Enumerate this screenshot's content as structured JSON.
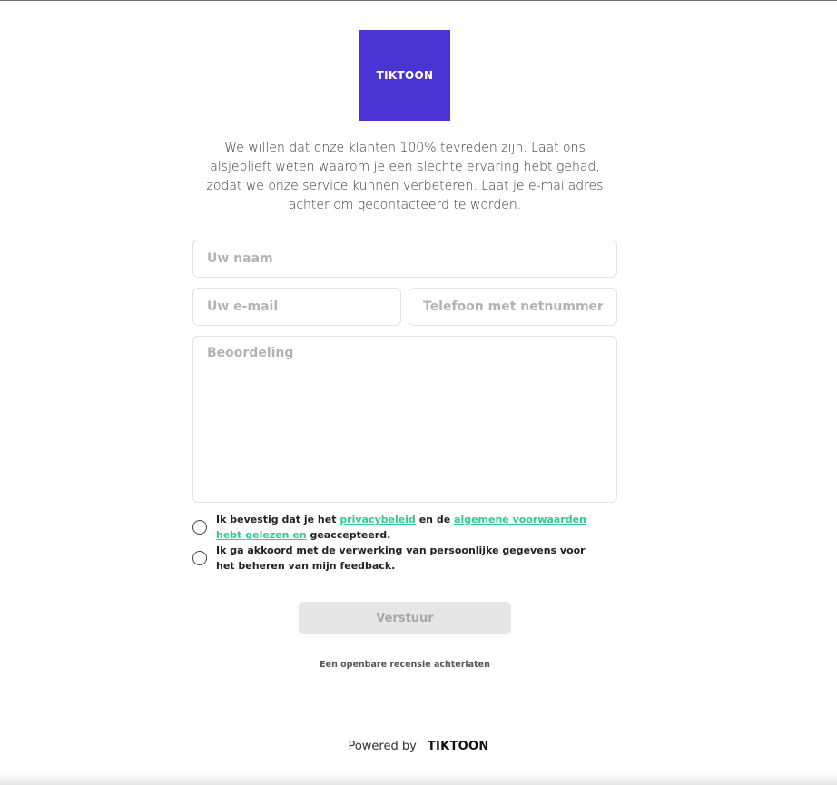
{
  "brand": {
    "logo_text": "TIKTOON",
    "logo_color": "#4a35d4"
  },
  "intro_text": "We willen dat onze klanten 100% tevreden zijn. Laat ons alsjeblieft weten waarom je een slechte ervaring hebt gehad, zodat we onze service kunnen verbeteren. Laat je e-mailadres achter om gecontacteerd te worden.",
  "form": {
    "name_placeholder": "Uw naam",
    "email_placeholder": "Uw e-mail",
    "phone_placeholder": "Telefoon met netnummer",
    "review_placeholder": "Beoordeling",
    "consent_privacy": {
      "text_before": "Ik bevestig dat je het ",
      "privacy_link": "privacybeleid",
      "text_middle": " en de ",
      "terms_link": "algemene voorwaarden hebt gelezen en",
      "text_after": " geaccepteerd."
    },
    "consent_data": "Ik ga akkoord met de verwerking van persoonlijke gegevens voor het beheren van mijn feedback.",
    "submit_label": "Verstuur",
    "public_review_link": "Een openbare recensie achterlaten"
  },
  "footer": {
    "powered_by": "Powered by",
    "brand": "TIKTOON"
  },
  "colors": {
    "accent_link": "#2ecc8f",
    "button_disabled_bg": "#e6e6e6"
  }
}
